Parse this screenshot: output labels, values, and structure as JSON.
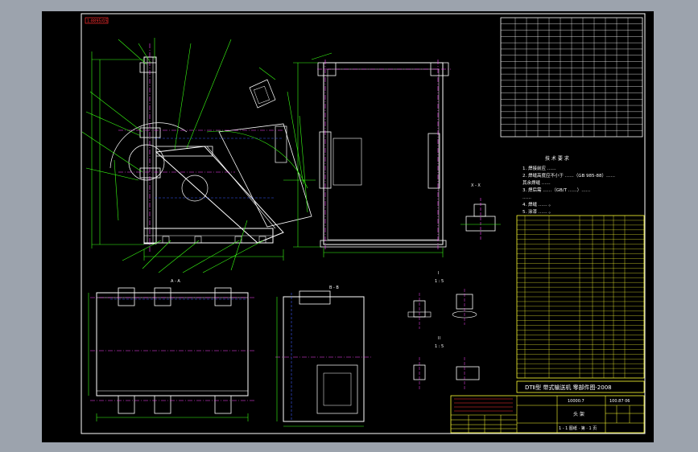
{
  "drawing": {
    "corner_tag": "1:8895/05",
    "title_strip": "DTⅡ型  带式输送机  零部件图·2008",
    "title_code": "10000.7",
    "title_code2": "100.87 06",
    "title_name": "头 架",
    "title_sheet": "1 - 1 图纸 · 第 · 1 页",
    "note_heading": "技  术  要  求",
    "notes": [
      "1. 焊接前应 ……",
      "2. 焊缝高度应不小于 ……（GB 985-88）……",
      "   其余焊缝 ……",
      "3. 焊后需 ……（GB/T ……）……",
      "   ……",
      "4. 焊缝 …… 。",
      "5. 涂漆 …… 。"
    ],
    "view_labels": {
      "a_a": "A - A",
      "b_b": "B - B",
      "x_x": "X - X",
      "scale_a": "1 : 5",
      "scale_b": "1 : 5",
      "detail_i": "I",
      "detail_ii": "II"
    },
    "colors": {
      "frame": "#ffffff",
      "outline": "#ffffff",
      "dim": "#39ff14",
      "center": "#ff44ff",
      "hidden": "#3b5bff",
      "table": "#ffff33",
      "text": "#ffffff",
      "red": "#ff3030"
    }
  }
}
